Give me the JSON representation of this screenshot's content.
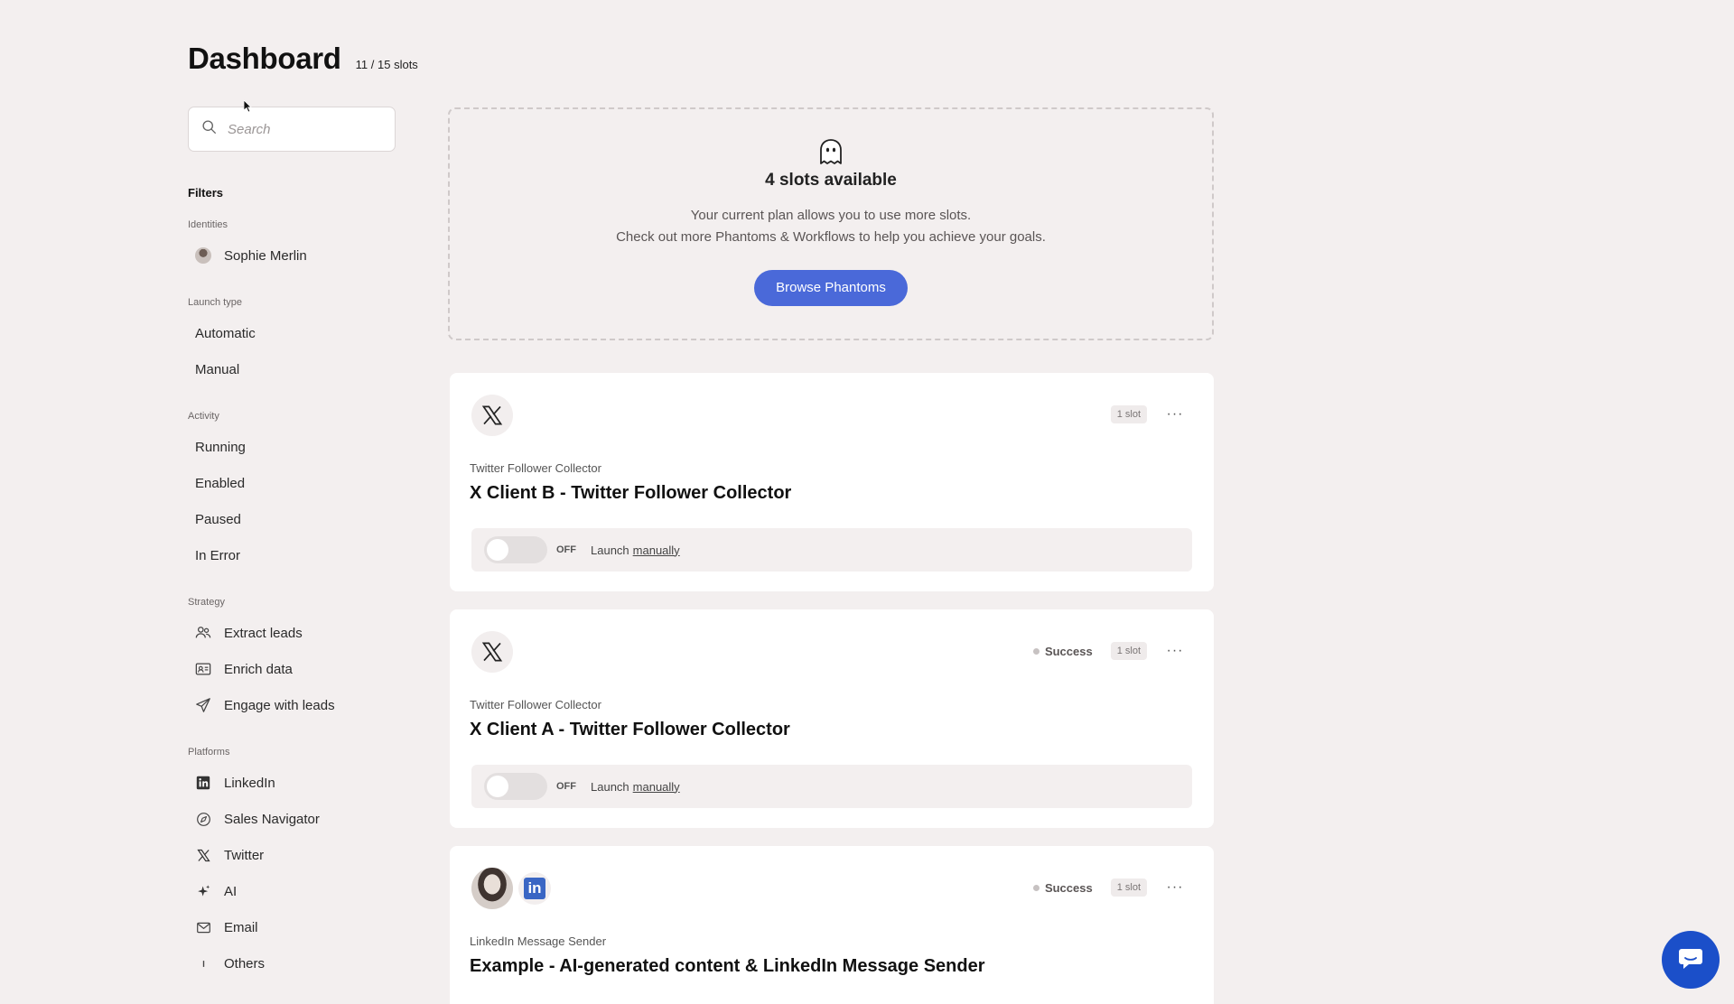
{
  "header": {
    "title": "Dashboard",
    "slots_count": "11 / 15 slots"
  },
  "search": {
    "placeholder": "Search",
    "icon": "search-icon"
  },
  "filters": {
    "title": "Filters",
    "groups": [
      {
        "label": "Identities",
        "items": [
          {
            "label": "Sophie Merlin",
            "icon": "avatar-icon"
          }
        ]
      },
      {
        "label": "Launch type",
        "items": [
          {
            "label": "Automatic"
          },
          {
            "label": "Manual"
          }
        ]
      },
      {
        "label": "Activity",
        "items": [
          {
            "label": "Running"
          },
          {
            "label": "Enabled"
          },
          {
            "label": "Paused"
          },
          {
            "label": "In Error"
          }
        ]
      },
      {
        "label": "Strategy",
        "items": [
          {
            "label": "Extract leads",
            "icon": "users-icon"
          },
          {
            "label": "Enrich data",
            "icon": "id-card-icon"
          },
          {
            "label": "Engage with leads",
            "icon": "send-icon"
          }
        ]
      },
      {
        "label": "Platforms",
        "items": [
          {
            "label": "LinkedIn",
            "icon": "linkedin-icon"
          },
          {
            "label": "Sales Navigator",
            "icon": "compass-icon"
          },
          {
            "label": "Twitter",
            "icon": "x-icon"
          },
          {
            "label": "AI",
            "icon": "sparkle-icon"
          },
          {
            "label": "Email",
            "icon": "mail-icon"
          },
          {
            "label": "Others",
            "icon": "others-icon"
          }
        ]
      }
    ]
  },
  "slots_available": {
    "title": "4 slots available",
    "line1": "Your current plan allows you to use more slots.",
    "line2": "Check out more Phantoms & Workflows to help you achieve your goals.",
    "button": "Browse Phantoms",
    "icon": "ghost-icon"
  },
  "cards": [
    {
      "subtitle": "Twitter Follower Collector",
      "title": "X Client B - Twitter Follower Collector",
      "status": "",
      "slot": "1 slot",
      "toggle": "OFF",
      "launch_prefix": "Launch",
      "launch_link": "manually",
      "logo": "x-icon"
    },
    {
      "subtitle": "Twitter Follower Collector",
      "title": "X Client A - Twitter Follower Collector",
      "status": "Success",
      "slot": "1 slot",
      "toggle": "OFF",
      "launch_prefix": "Launch",
      "launch_link": "manually",
      "logo": "x-icon"
    },
    {
      "subtitle": "LinkedIn Message Sender",
      "title": "Example - AI-generated content & LinkedIn Message Sender",
      "status": "Success",
      "slot": "1 slot",
      "logo": "linkedin-icon"
    }
  ],
  "more_label": "···",
  "li_letter": "in",
  "chat": {
    "icon": "chat-icon"
  },
  "colors": {
    "background": "#f3efef",
    "primary": "#4a69d9",
    "chat": "#1b4fc9"
  }
}
